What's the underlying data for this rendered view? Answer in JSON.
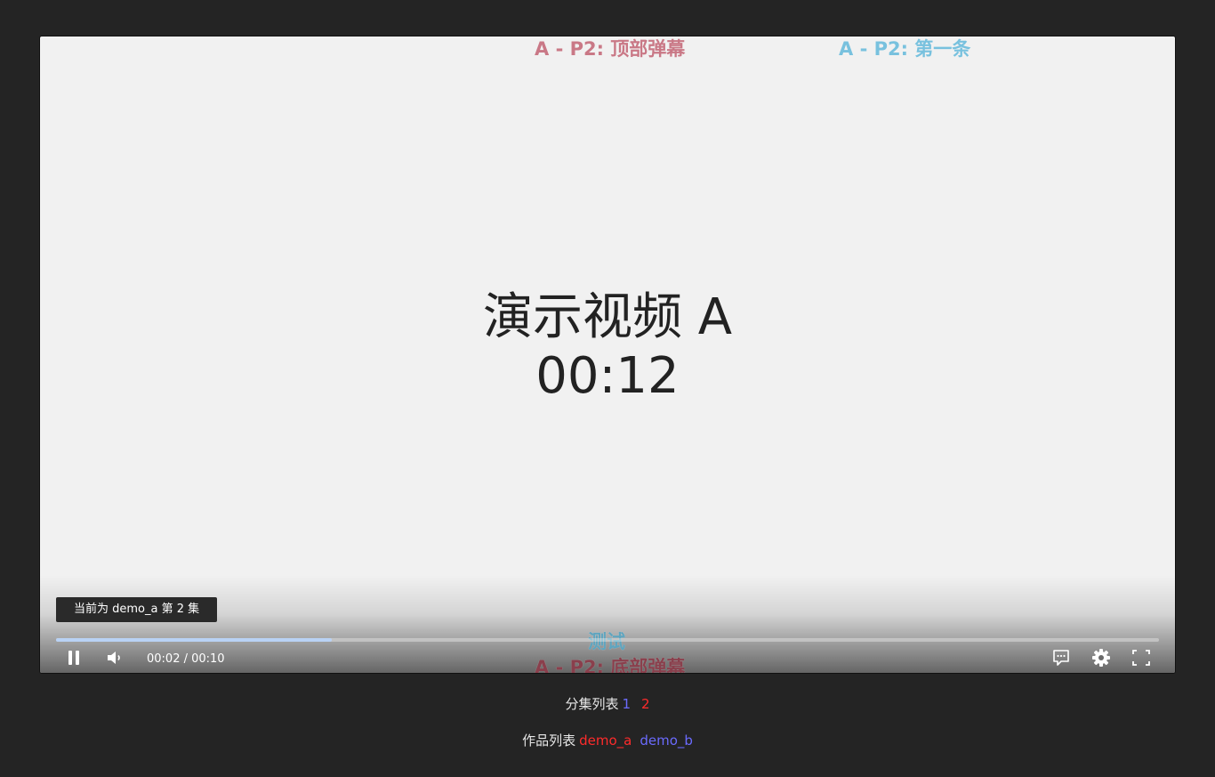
{
  "video": {
    "title_line1": "演示视频 A",
    "title_line2": "00:12"
  },
  "danmaku": {
    "top_1": {
      "text": "A - P2: 顶部弹幕",
      "color": "#c97886"
    },
    "top_2": {
      "text": "A - P2: 第一条",
      "color": "#78c1de"
    },
    "bottom_1": {
      "text": "测试",
      "color": "#5fa5bf"
    },
    "bottom_2": {
      "text": "A - P2: 底部弹幕",
      "color": "#8a3f4c"
    }
  },
  "tooltip": "当前为 demo_a 第 2 集",
  "controls": {
    "progress_fraction": 0.25,
    "time_display": "00:02 / 00:10",
    "icons": [
      "pause-icon",
      "volume-icon",
      "danmaku-toggle-icon",
      "settings-gear-icon",
      "fullscreen-icon"
    ]
  },
  "episodes": {
    "label": "分集列表",
    "items": [
      {
        "label": "1",
        "color": "#6b6bff"
      },
      {
        "label": "2",
        "color": "#ff2b2b"
      }
    ]
  },
  "works": {
    "label": "作品列表",
    "items": [
      {
        "label": "demo_a",
        "color": "#ff2b2b"
      },
      {
        "label": "demo_b",
        "color": "#6b6bff"
      }
    ]
  }
}
